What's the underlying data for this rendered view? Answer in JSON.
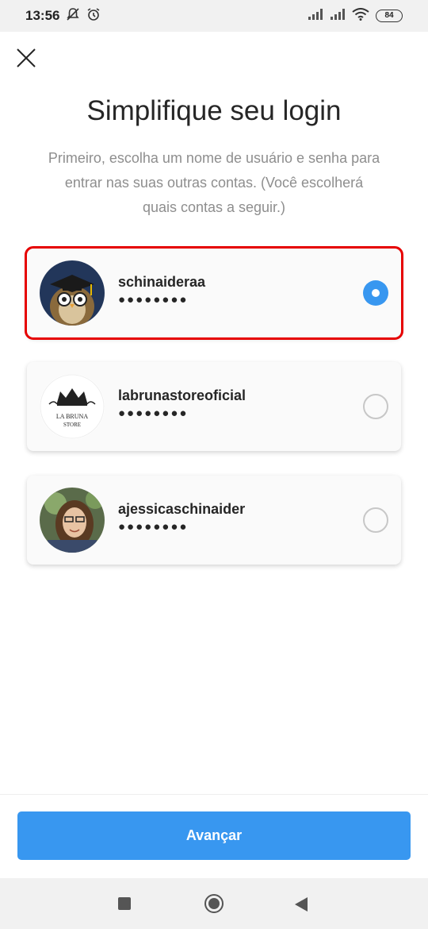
{
  "status_bar": {
    "time": "13:56",
    "battery": "84",
    "icons": [
      "notifications-off-icon",
      "alarm-icon",
      "signal-icon",
      "signal-icon",
      "wifi-icon",
      "battery-icon"
    ]
  },
  "header": {
    "close_icon": "close-icon",
    "title": "Simplifique seu login",
    "subtitle": "Primeiro, escolha um nome de usuário e senha para entrar nas suas outras contas. (Você escolherá quais contas a seguir.)"
  },
  "accounts": [
    {
      "username": "schinaideraa",
      "password_mask": "●●●●●●●●",
      "selected": true
    },
    {
      "username": "labrunastoreoficial",
      "password_mask": "●●●●●●●●",
      "selected": false,
      "avatar_text": "LA BRUNA STORE"
    },
    {
      "username": "ajessicaschinaider",
      "password_mask": "●●●●●●●●",
      "selected": false
    }
  ],
  "footer": {
    "next_label": "Avançar"
  },
  "colors": {
    "accent": "#3897f0",
    "highlight": "#e60000"
  }
}
